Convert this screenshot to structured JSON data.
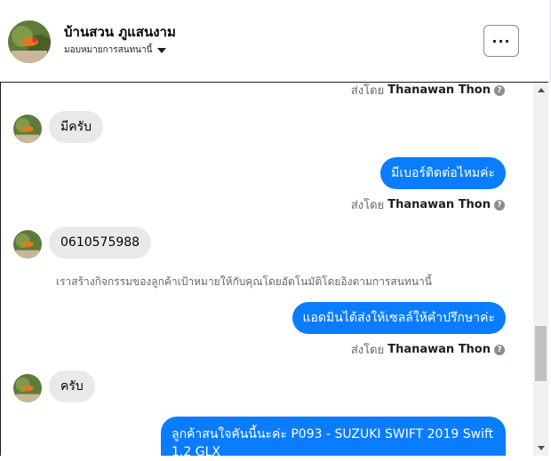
{
  "header": {
    "page_name": "บ้านสวน ภูแสนงาม",
    "assign_label": "มอบหมายการสนทนานี้",
    "more_label": "···"
  },
  "messages": {
    "top_sent_by": {
      "prefix": "ส่งโดย",
      "name": "Thanawan Thon"
    },
    "m1": {
      "text": "มีครับ"
    },
    "m2": {
      "text": "มีเบอร์ติดต่อไหมค่ะ",
      "sent_by_prefix": "ส่งโดย",
      "sent_by_name": "Thanawan Thon"
    },
    "m3": {
      "text": "0610575988"
    },
    "system_note": "เราสร้างกิจกรรมของลูกค้าเป้าหมายให้กับคุณโดยอัตโนมัติโดยอิงตามการสนทนานี้",
    "m4": {
      "text": "แอดมินได้ส่งให้เซลล์ให้คำปรึกษาค่ะ",
      "sent_by_prefix": "ส่งโดย",
      "sent_by_name": "Thanawan Thon"
    },
    "m5": {
      "text": "ครับ"
    },
    "m6": {
      "text": "ลูกค้าสนใจคันนี้นะค่ะ P093 - SUZUKI SWIFT 2019 Swift 1.2 GLX"
    }
  },
  "icons": {
    "info": "?",
    "avatar": "profile-photo-icon"
  },
  "colors": {
    "outgoing_bubble": "#0a7cff",
    "incoming_bubble": "#e9e9eb"
  }
}
